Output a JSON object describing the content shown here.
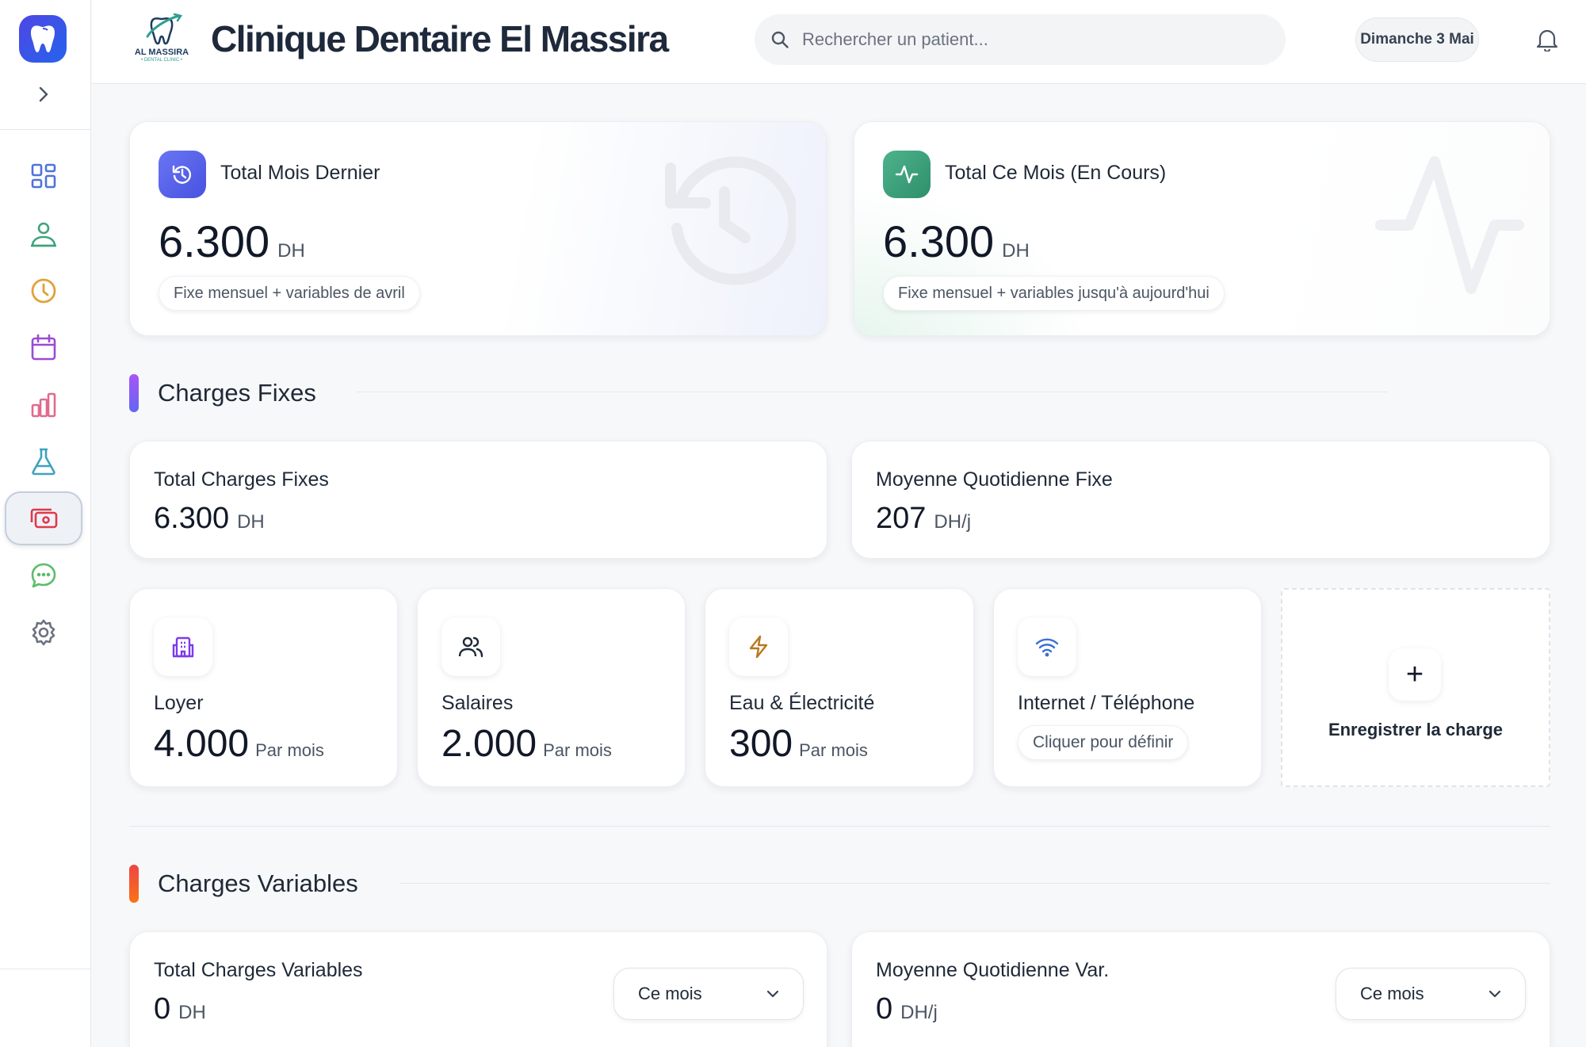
{
  "header": {
    "clinic_title": "Clinique Dentaire El Massira",
    "logo_text": "AL MASSIRA",
    "logo_subtext": "• DENTAL CLINIC •",
    "search_placeholder": "Rechercher un patient...",
    "date": "Dimanche 3 Mai"
  },
  "sidebar": {
    "items": [
      {
        "name": "dashboard",
        "icon": "grid-icon",
        "color": "#4f73d9"
      },
      {
        "name": "patients",
        "icon": "users-icon",
        "color": "#3fa37b"
      },
      {
        "name": "history",
        "icon": "clock-icon",
        "color": "#e0a23a"
      },
      {
        "name": "calendar",
        "icon": "calendar-icon",
        "color": "#9b4bd6"
      },
      {
        "name": "stats",
        "icon": "bar-chart-icon",
        "color": "#e06b8b"
      },
      {
        "name": "lab",
        "icon": "flask-icon",
        "color": "#3fa3bd"
      },
      {
        "name": "charges",
        "icon": "money-icon",
        "color": "#e0394b",
        "active": true
      },
      {
        "name": "messages",
        "icon": "chat-icon",
        "color": "#5bbd6c"
      },
      {
        "name": "settings",
        "icon": "gear-icon",
        "color": "#6b7280"
      }
    ]
  },
  "summary": {
    "last_month": {
      "title": "Total Mois Dernier",
      "amount": "6.300",
      "unit": "DH",
      "note": "Fixe mensuel + variables de avril",
      "color": "#5b6cf0"
    },
    "this_month": {
      "title": "Total Ce Mois (En Cours)",
      "amount": "6.300",
      "unit": "DH",
      "note": "Fixe mensuel + variables jusqu'à aujourd'hui",
      "color": "#3fa37b"
    }
  },
  "fixed": {
    "section_title": "Charges Fixes",
    "total": {
      "label": "Total Charges Fixes",
      "value": "6.300",
      "unit": "DH"
    },
    "daily": {
      "label": "Moyenne Quotidienne Fixe",
      "value": "207",
      "unit": "DH/j"
    },
    "categories": [
      {
        "name": "Loyer",
        "value": "4.000",
        "per": "Par mois",
        "icon": "building-icon",
        "color": "#7c3aed"
      },
      {
        "name": "Salaires",
        "value": "2.000",
        "per": "Par mois",
        "icon": "people-icon",
        "color": "#1f2937"
      },
      {
        "name": "Eau & Électricité",
        "value": "300",
        "per": "Par mois",
        "icon": "lightning-icon",
        "color": "#b7791f"
      },
      {
        "name": "Internet / Téléphone",
        "define": "Cliquer pour définir",
        "icon": "wifi-icon",
        "color": "#3b6fd6"
      }
    ],
    "add_label": "Enregistrer la charge"
  },
  "variable": {
    "section_title": "Charges Variables",
    "total": {
      "label": "Total Charges Variables",
      "value": "0",
      "unit": "DH",
      "period": "Ce mois"
    },
    "daily": {
      "label": "Moyenne Quotidienne Var.",
      "value": "0",
      "unit": "DH/j",
      "period": "Ce mois"
    }
  }
}
